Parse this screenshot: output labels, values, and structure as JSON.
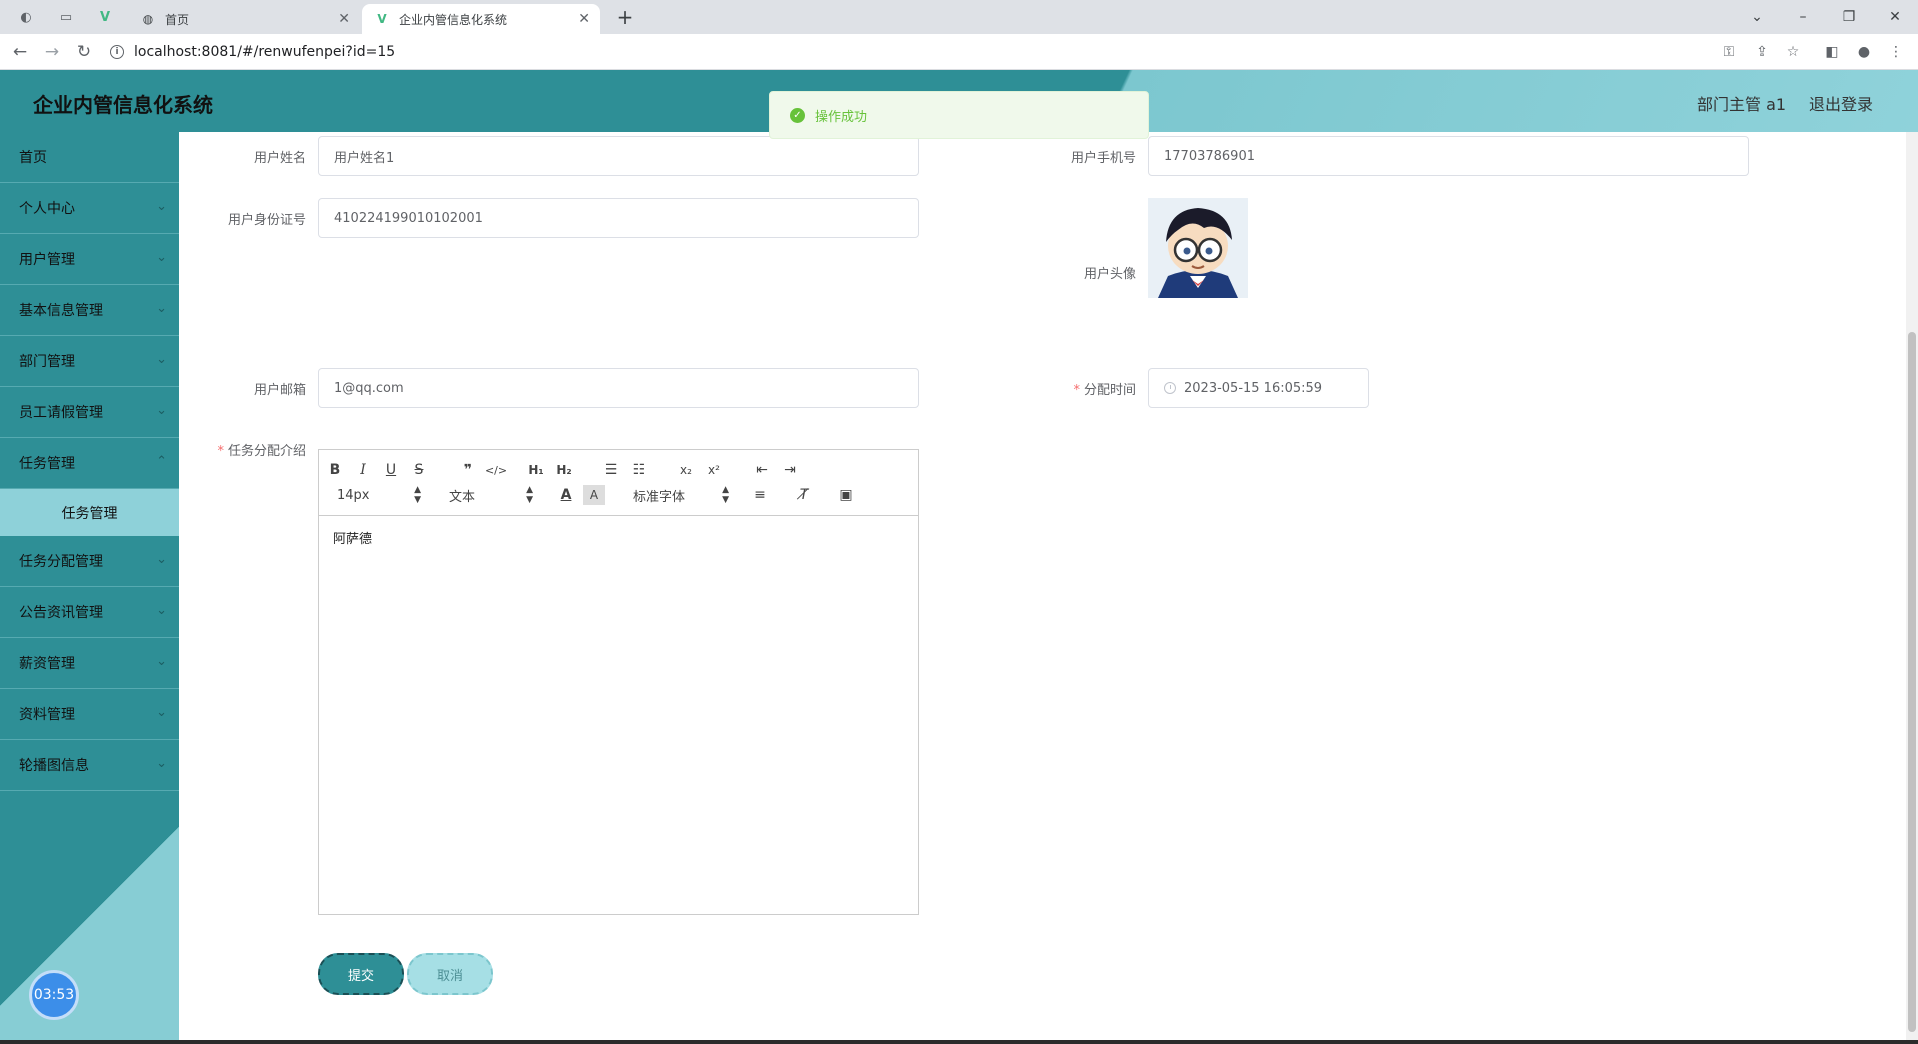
{
  "browser": {
    "tabs": [
      {
        "title": "首页",
        "close": "✕"
      },
      {
        "title": "企业内管信息化系统",
        "close": "✕"
      }
    ],
    "new_tab": "+",
    "url": "localhost:8081/#/renwufenpei?id=15"
  },
  "header": {
    "title": "企业内管信息化系统",
    "user": "部门主管 a1",
    "logout": "退出登录"
  },
  "toast": {
    "message": "操作成功",
    "color": "#67c23a"
  },
  "sidebar": {
    "items": [
      {
        "label": "首页"
      },
      {
        "label": "个人中心"
      },
      {
        "label": "用户管理"
      },
      {
        "label": "基本信息管理"
      },
      {
        "label": "部门管理"
      },
      {
        "label": "员工请假管理"
      },
      {
        "label": "任务管理"
      },
      {
        "label": "任务分配管理"
      },
      {
        "label": "公告资讯管理"
      },
      {
        "label": "薪资管理"
      },
      {
        "label": "资料管理"
      },
      {
        "label": "轮播图信息"
      }
    ],
    "submenu_label": "任务管理",
    "clock": "03:53",
    "accent": "#2e8f96"
  },
  "form": {
    "username_label": "用户姓名",
    "username_value": "用户姓名1",
    "phone_label": "用户手机号",
    "phone_value": "17703786901",
    "idcard_label": "用户身份证号",
    "idcard_value": "410224199010102001",
    "avatar_label": "用户头像",
    "email_label": "用户邮箱",
    "email_value": "1@qq.com",
    "time_label": "分配时间",
    "time_value": "2023-05-15 16:05:59",
    "intro_label": "任务分配介绍",
    "required_mark": "*"
  },
  "editor": {
    "font_size": "14px",
    "block_format": "文本",
    "font_family": "标准字体",
    "content": "阿萨德"
  },
  "buttons": {
    "submit": "提交",
    "cancel": "取消"
  }
}
